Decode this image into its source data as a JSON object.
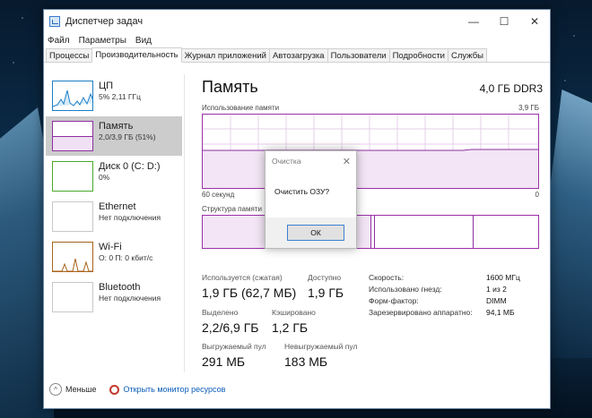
{
  "window": {
    "title": "Диспетчер задач"
  },
  "menu": [
    "Файл",
    "Параметры",
    "Вид"
  ],
  "tabs": [
    "Процессы",
    "Производительность",
    "Журнал приложений",
    "Автозагрузка",
    "Пользователи",
    "Подробности",
    "Службы"
  ],
  "resources": [
    {
      "name": "ЦП",
      "detail": "5% 2,11 ГГц",
      "color": "#1b7fc7"
    },
    {
      "name": "Память",
      "detail": "2,0/3,9 ГБ (51%)",
      "color": "#8e2fa0"
    },
    {
      "name": "Диск 0 (C: D:)",
      "detail": "0%",
      "color": "#4aa82a"
    },
    {
      "name": "Ethernet",
      "detail": "Нет подключения",
      "color": "#a0a0a0"
    },
    {
      "name": "Wi-Fi",
      "detail": "О: 0 П: 0 кбит/с",
      "color": "#a8621a"
    },
    {
      "name": "Bluetooth",
      "detail": "Нет подключения",
      "color": "#a0a0a0"
    }
  ],
  "memory": {
    "title": "Память",
    "spec": "4,0 ГБ DDR3",
    "usage_label": "Использование памяти",
    "usage_max": "3,9 ГБ",
    "time_left": "60 секунд",
    "time_right": "0",
    "structure_label": "Структура памяти",
    "usage_fraction": 0.51,
    "stats": {
      "in_use_label": "Используется (сжатая)",
      "in_use_value": "1,9 ГБ (62,7 МБ)",
      "available_label": "Доступно",
      "available_value": "1,9 ГБ",
      "committed_label": "Выделено",
      "committed_value": "2,2/6,9 ГБ",
      "cached_label": "Кэшировано",
      "cached_value": "1,2 ГБ",
      "paged_label": "Выгружаемый пул",
      "paged_value": "291 МБ",
      "nonpaged_label": "Невыгружаемый пул",
      "nonpaged_value": "183 МБ"
    },
    "details": [
      {
        "label": "Скорость:",
        "value": "1600 МГц"
      },
      {
        "label": "Использовано гнезд:",
        "value": "1 из 2"
      },
      {
        "label": "Форм-фактор:",
        "value": "DIMM"
      },
      {
        "label": "Зарезервировано аппаратно:",
        "value": "94,1 МБ"
      }
    ]
  },
  "footer": {
    "less": "Меньше",
    "monitor_link": "Открыть монитор ресурсов"
  },
  "dialog": {
    "title": "Очистка",
    "message": "Очистить ОЗУ?",
    "ok": "ОК"
  }
}
